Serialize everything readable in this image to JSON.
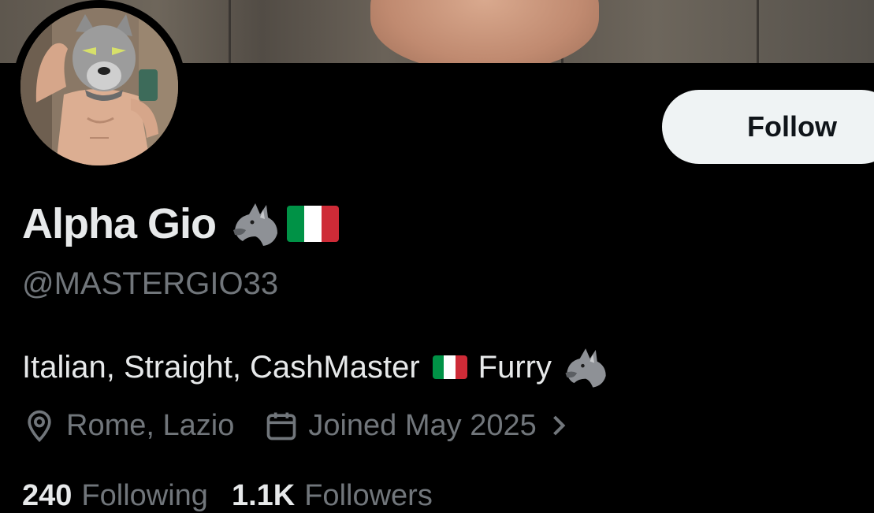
{
  "profile": {
    "display_name": "Alpha Gio",
    "handle": "@MASTERGIO33",
    "bio_text": "Italian, Straight, CashMaster",
    "bio_text_2": "Furry",
    "location": "Rome, Lazio",
    "joined": "Joined May 2025",
    "following_count": "240",
    "following_label": "Following",
    "followers_count": "1.1K",
    "followers_label": "Followers"
  },
  "actions": {
    "follow_label": "Follow"
  },
  "icons": {
    "name_emojis": [
      "wolf-emoji",
      "italy-flag-emoji"
    ],
    "bio_emojis": [
      "italy-flag-emoji",
      "wolf-emoji"
    ],
    "location": "location-pin-icon",
    "joined": "calendar-icon",
    "joined_more": "chevron-right-icon"
  },
  "colors": {
    "background": "#000000",
    "primary_text": "#e7e9ea",
    "secondary_text": "#71767b",
    "follow_button_bg": "#eff3f4",
    "flag_green": "#009246",
    "flag_white": "#ffffff",
    "flag_red": "#ce2b37"
  }
}
